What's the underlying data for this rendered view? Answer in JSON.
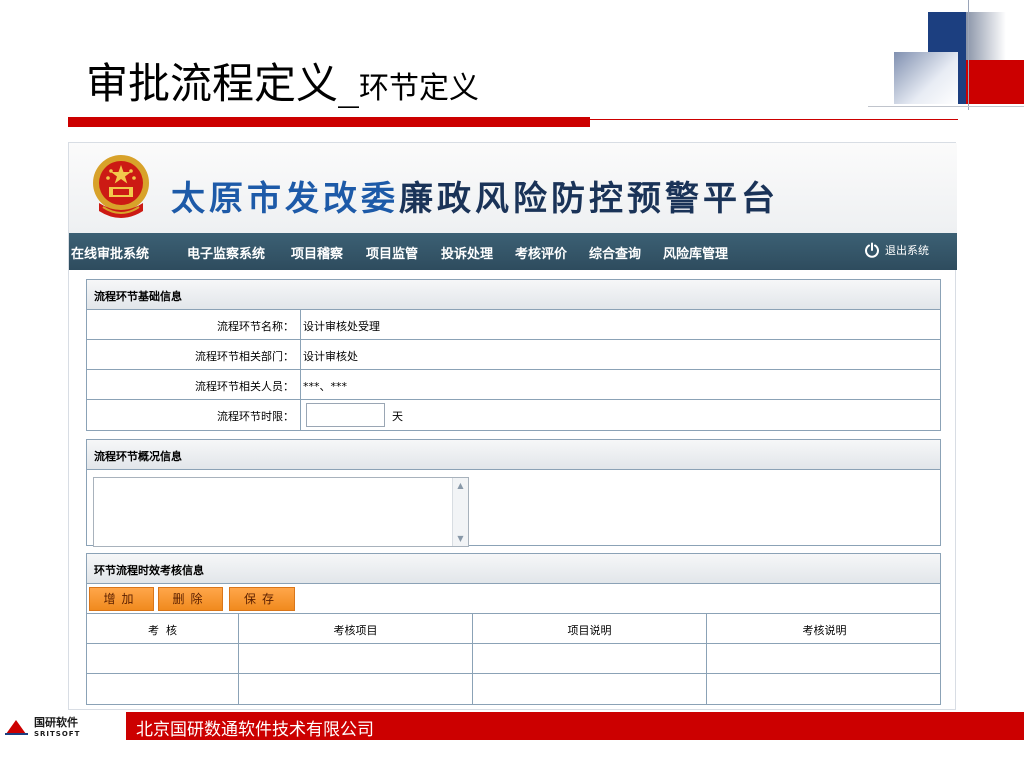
{
  "slide": {
    "title_main": "审批流程定义_",
    "title_sub": "环节定义"
  },
  "app": {
    "banner_part1": "太原市发改委",
    "banner_part2": "廉政风险防控预警平台",
    "nav": [
      {
        "label": "在线审批系统"
      },
      {
        "label": "电子监察系统"
      },
      {
        "label": "项目稽察"
      },
      {
        "label": "项目监管"
      },
      {
        "label": "投诉处理"
      },
      {
        "label": "考核评价"
      },
      {
        "label": "综合查询"
      },
      {
        "label": "风险库管理"
      }
    ],
    "logout_label": "退出系统",
    "basic_panel": {
      "header": "流程环节基础信息",
      "rows": [
        {
          "label": "流程环节名称：",
          "value": "设计审核处受理"
        },
        {
          "label": "流程环节相关部门：",
          "value": "设计审核处"
        },
        {
          "label": "流程环节相关人员：",
          "value": "***、***"
        }
      ],
      "time_limit_label": "流程环节时限：",
      "time_limit_value": "",
      "time_limit_unit": "天"
    },
    "overview_panel": {
      "header": "流程环节概况信息",
      "textarea_value": ""
    },
    "assess_panel": {
      "header": "环节流程时效考核信息",
      "buttons": {
        "add": "增加",
        "delete": "删除",
        "save": "保存"
      },
      "columns": [
        "考  核",
        "考核项目",
        "项目说明",
        "考核说明"
      ],
      "rows": [
        [
          "",
          "",
          "",
          ""
        ],
        [
          "",
          "",
          "",
          ""
        ]
      ]
    }
  },
  "footer": {
    "logo_cn": "国研软件",
    "logo_en": "SRITSOFT",
    "company": "北京国研数通软件技术有限公司"
  },
  "colors": {
    "accent_red": "#cc0000",
    "nav_bg": "#2e4c5e",
    "banner_blue": "#1d5aa8",
    "button_orange": "#f08a1e"
  }
}
